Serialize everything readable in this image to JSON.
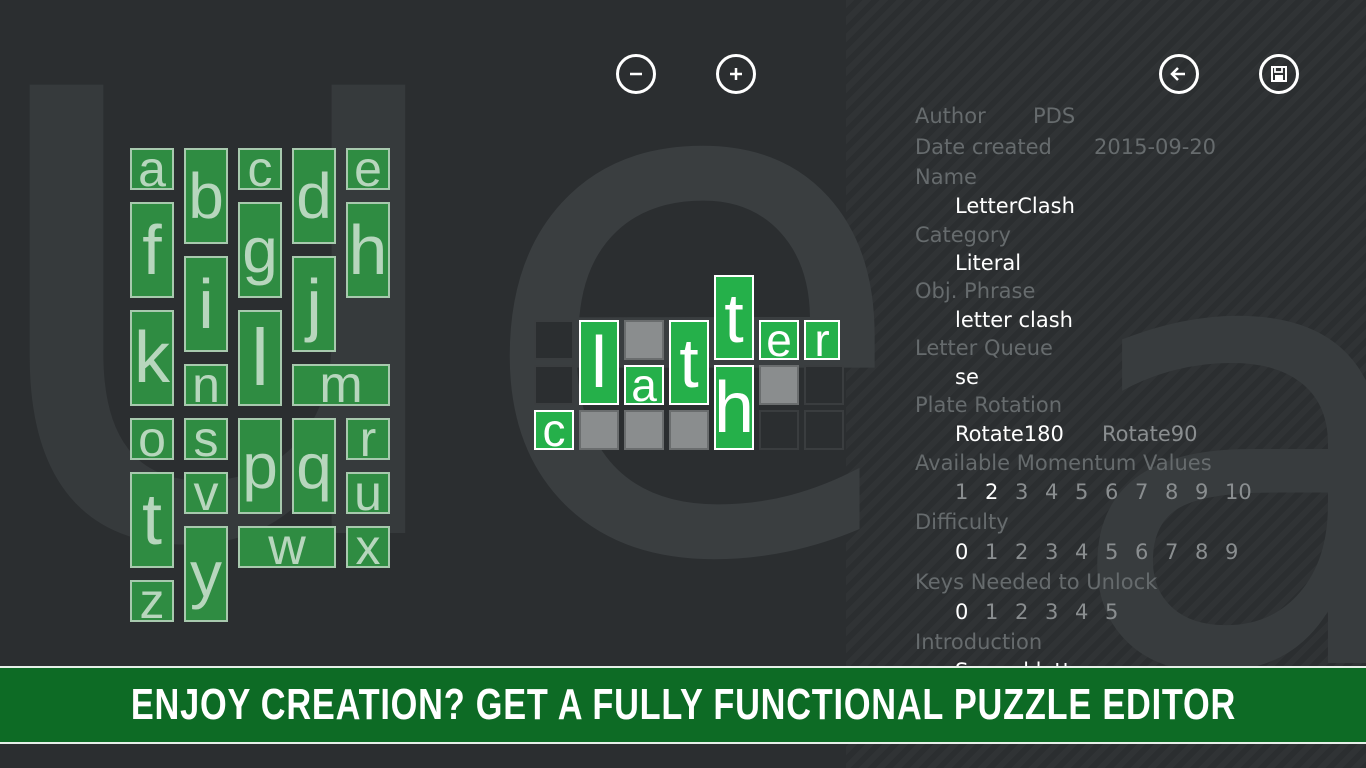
{
  "toolbar": {
    "zoom_out_icon": "minus-circle-icon",
    "zoom_in_icon": "plus-circle-icon",
    "back_icon": "back-arrow-icon",
    "save_icon": "save-disk-icon"
  },
  "palette": {
    "letters": [
      "a",
      "b",
      "c",
      "d",
      "e",
      "f",
      "g",
      "h",
      "i",
      "j",
      "k",
      "l",
      "m",
      "n",
      "o",
      "p",
      "q",
      "r",
      "s",
      "t",
      "u",
      "v",
      "w",
      "x",
      "y",
      "z"
    ]
  },
  "puzzle": {
    "tiles": [
      "c",
      "l",
      "a",
      "t",
      "t",
      "e",
      "r",
      "h",
      "t"
    ]
  },
  "properties": {
    "author_label": "Author",
    "author_value": "PDS",
    "date_label": "Date created",
    "date_value": "2015-09-20",
    "name_label": "Name",
    "name_value": "LetterClash",
    "category_label": "Category",
    "category_value": "Literal",
    "phrase_label": "Obj. Phrase",
    "phrase_value": "letter clash",
    "queue_label": "Letter Queue",
    "queue_value": "se",
    "rotation_label": "Plate Rotation",
    "rotation_options": [
      "Rotate180",
      "Rotate90"
    ],
    "momentum_label": "Available Momentum Values",
    "momentum_options": [
      "1",
      "2",
      "3",
      "4",
      "5",
      "6",
      "7",
      "8",
      "9",
      "10"
    ],
    "difficulty_label": "Difficulty",
    "difficulty_options": [
      "0",
      "1",
      "2",
      "3",
      "4",
      "5",
      "6",
      "7",
      "8",
      "9"
    ],
    "keys_label": "Keys Needed to Unlock",
    "keys_options": [
      "0",
      "1",
      "2",
      "3",
      "4",
      "5"
    ],
    "intro_label": "Introduction",
    "intro_value": "Spread letters"
  },
  "banner": {
    "text": "ENJOY CREATION? GET A FULLY FUNCTIONAL PUZZLE EDITOR"
  },
  "colors": {
    "tile_green": "#2f8c42",
    "puzzle_green": "#25b04a",
    "banner_green": "#0d6b25",
    "background": "#2b2e30"
  }
}
